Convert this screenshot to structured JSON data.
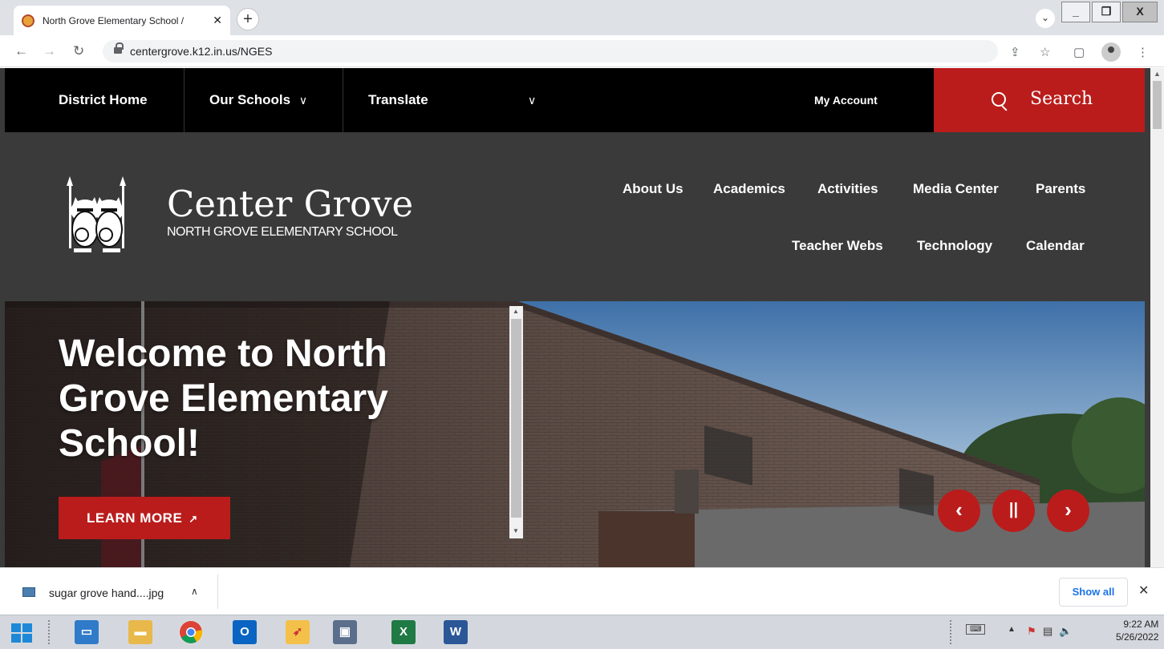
{
  "browser": {
    "tab_title": "North Grove Elementary School /",
    "tab_close": "✕",
    "new_tab": "+",
    "url": "centergrove.k12.in.us/NGES"
  },
  "site": {
    "top_nav": {
      "district_home": "District Home",
      "our_schools": "Our Schools",
      "translate": "Translate",
      "my_account": "My Account",
      "search": "Search"
    },
    "brand": {
      "name": "Center Grove",
      "subtitle": "NORTH GROVE ELEMENTARY SCHOOL"
    },
    "main_nav": [
      {
        "label": "About Us"
      },
      {
        "label": "Academics"
      },
      {
        "label": "Activities"
      },
      {
        "label": "Media Center"
      },
      {
        "label": "Parents"
      },
      {
        "label": "Teacher Webs"
      },
      {
        "label": "Technology"
      },
      {
        "label": "Calendar"
      }
    ],
    "hero": {
      "title": "Welcome to North Grove Elementary School!",
      "cta": "LEARN MORE",
      "cta_icon": "↗"
    }
  },
  "download_bar": {
    "file_name": "sugar grove hand....jpg",
    "show_all": "Show all"
  },
  "taskbar": {
    "time": "9:22 AM",
    "date": "5/26/2022"
  },
  "colors": {
    "brand_red": "#ba1c1c",
    "header_gray": "#3a3a3a",
    "top_nav_black": "#000000"
  }
}
